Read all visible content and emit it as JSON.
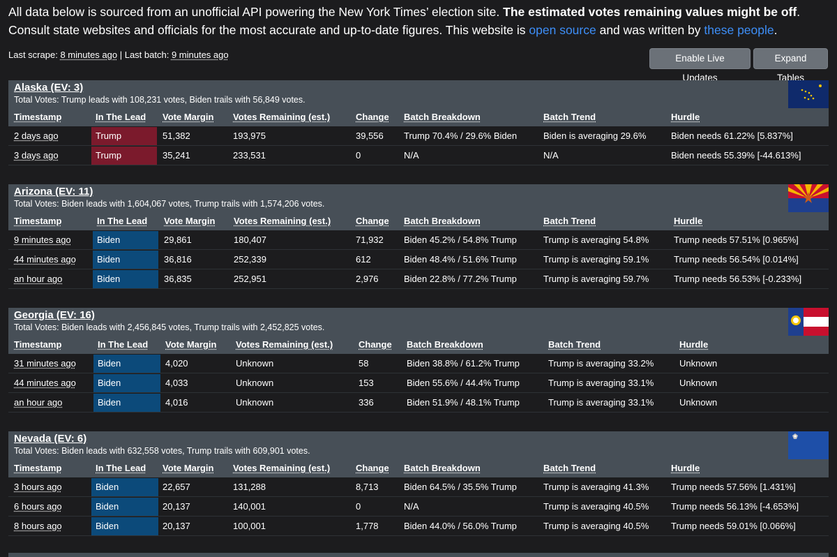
{
  "intro": {
    "part1": "All data below is sourced from an unofficial API powering the New York Times’ election site. ",
    "bold": "The estimated votes remaining values might be off",
    "part2": ". Consult state websites and officials for the most accurate and up-to-date figures. This website is ",
    "link1": "open source",
    "part3": " and was written by ",
    "link2": "these people",
    "part4": "."
  },
  "scrape": {
    "scrape_label": "Last scrape: ",
    "scrape_value": "8 minutes ago",
    "sep": " | ",
    "batch_label": "Last batch: ",
    "batch_value": "9 minutes ago"
  },
  "buttons": {
    "live": "Enable Live Updates",
    "expand": "Expand Tables"
  },
  "columns": [
    "Timestamp",
    "In The Lead",
    "Vote Margin",
    "Votes Remaining (est.)",
    "Change",
    "Batch Breakdown",
    "Batch Trend",
    "Hurdle"
  ],
  "colors": {
    "trump": "#7b1a2c",
    "biden": "#0c4a7a",
    "header_bg": "#474f57",
    "link": "#3d8ef7"
  },
  "states": [
    {
      "title": "Alaska (EV: 3)",
      "total": "Total Votes: Trump leads with 108,231 votes, Biden trails with 56,849 votes.",
      "flag": "alaska-flag",
      "rows": [
        {
          "ts": "2 days ago",
          "lead": "Trump",
          "margin": "51,382",
          "remaining": "193,975",
          "change": "39,556",
          "breakdown": "Trump 70.4% / 29.6% Biden",
          "trend": "Biden is averaging 29.6%",
          "hurdle": "Biden needs 61.22% [5.837%]"
        },
        {
          "ts": "3 days ago",
          "lead": "Trump",
          "margin": "35,241",
          "remaining": "233,531",
          "change": "0",
          "breakdown": "N/A",
          "trend": "N/A",
          "hurdle": "Biden needs 55.39% [-44.613%]"
        }
      ]
    },
    {
      "title": "Arizona (EV: 11)",
      "total": "Total Votes: Biden leads with 1,604,067 votes, Trump trails with 1,574,206 votes.",
      "flag": "arizona-flag",
      "rows": [
        {
          "ts": "9 minutes ago",
          "lead": "Biden",
          "margin": "29,861",
          "remaining": "180,407",
          "change": "71,932",
          "breakdown": "Biden 45.2% / 54.8% Trump",
          "trend": "Trump is averaging 54.8%",
          "hurdle": "Trump needs 57.51% [0.965%]"
        },
        {
          "ts": "44 minutes ago",
          "lead": "Biden",
          "margin": "36,816",
          "remaining": "252,339",
          "change": "612",
          "breakdown": "Biden 48.4% / 51.6% Trump",
          "trend": "Trump is averaging 59.1%",
          "hurdle": "Trump needs 56.54% [0.014%]"
        },
        {
          "ts": "an hour ago",
          "lead": "Biden",
          "margin": "36,835",
          "remaining": "252,951",
          "change": "2,976",
          "breakdown": "Biden 22.8% / 77.2% Trump",
          "trend": "Trump is averaging 59.7%",
          "hurdle": "Trump needs 56.53% [-0.233%]"
        }
      ]
    },
    {
      "title": "Georgia (EV: 16)",
      "total": "Total Votes: Biden leads with 2,456,845 votes, Trump trails with 2,452,825 votes.",
      "flag": "georgia-flag",
      "rows": [
        {
          "ts": "31 minutes ago",
          "lead": "Biden",
          "margin": "4,020",
          "remaining": "Unknown",
          "change": "58",
          "breakdown": "Biden 38.8% / 61.2% Trump",
          "trend": "Trump is averaging 33.2%",
          "hurdle": "Unknown"
        },
        {
          "ts": "44 minutes ago",
          "lead": "Biden",
          "margin": "4,033",
          "remaining": "Unknown",
          "change": "153",
          "breakdown": "Biden 55.6% / 44.4% Trump",
          "trend": "Trump is averaging 33.1%",
          "hurdle": "Unknown"
        },
        {
          "ts": "an hour ago",
          "lead": "Biden",
          "margin": "4,016",
          "remaining": "Unknown",
          "change": "336",
          "breakdown": "Biden 51.9% / 48.1% Trump",
          "trend": "Trump is averaging 33.1%",
          "hurdle": "Unknown"
        }
      ]
    },
    {
      "title": "Nevada (EV: 6)",
      "total": "Total Votes: Biden leads with 632,558 votes, Trump trails with 609,901 votes.",
      "flag": "nevada-flag",
      "rows": [
        {
          "ts": "3 hours ago",
          "lead": "Biden",
          "margin": "22,657",
          "remaining": "131,288",
          "change": "8,713",
          "breakdown": "Biden 64.5% / 35.5% Trump",
          "trend": "Trump is averaging 41.3%",
          "hurdle": "Trump needs 57.56% [1.431%]"
        },
        {
          "ts": "6 hours ago",
          "lead": "Biden",
          "margin": "20,137",
          "remaining": "140,001",
          "change": "0",
          "breakdown": "N/A",
          "trend": "Trump is averaging 40.5%",
          "hurdle": "Trump needs 56.13% [-4.653%]"
        },
        {
          "ts": "8 hours ago",
          "lead": "Biden",
          "margin": "20,137",
          "remaining": "100,001",
          "change": "1,778",
          "breakdown": "Biden 44.0% / 56.0% Trump",
          "trend": "Trump is averaging 40.5%",
          "hurdle": "Trump needs 59.01% [0.066%]"
        }
      ]
    }
  ]
}
